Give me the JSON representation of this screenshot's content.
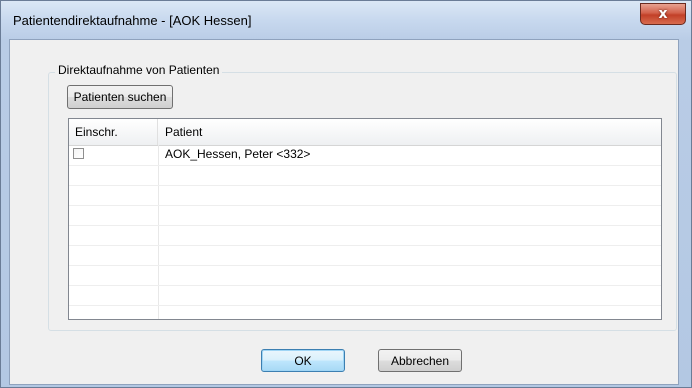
{
  "window": {
    "title": "Patientendirektaufnahme - [AOK Hessen]",
    "close_glyph": "x"
  },
  "group": {
    "label": "Direktaufnahme von Patienten"
  },
  "search_button": {
    "label": "Patienten suchen"
  },
  "table": {
    "columns": [
      "Einschr.",
      "Patient"
    ],
    "rows": [
      {
        "checked": false,
        "patient": "AOK_Hessen,  Peter <332>"
      },
      {
        "checked": false,
        "patient": ""
      },
      {
        "checked": false,
        "patient": ""
      },
      {
        "checked": false,
        "patient": ""
      },
      {
        "checked": false,
        "patient": ""
      },
      {
        "checked": false,
        "patient": ""
      },
      {
        "checked": false,
        "patient": ""
      },
      {
        "checked": false,
        "patient": ""
      }
    ]
  },
  "footer": {
    "ok_label": "OK",
    "cancel_label": "Abbrechen"
  },
  "colors": {
    "titlebar": "#c7d8ee",
    "close_button": "#c24028",
    "dialog_bg": "#f0f0f0"
  }
}
